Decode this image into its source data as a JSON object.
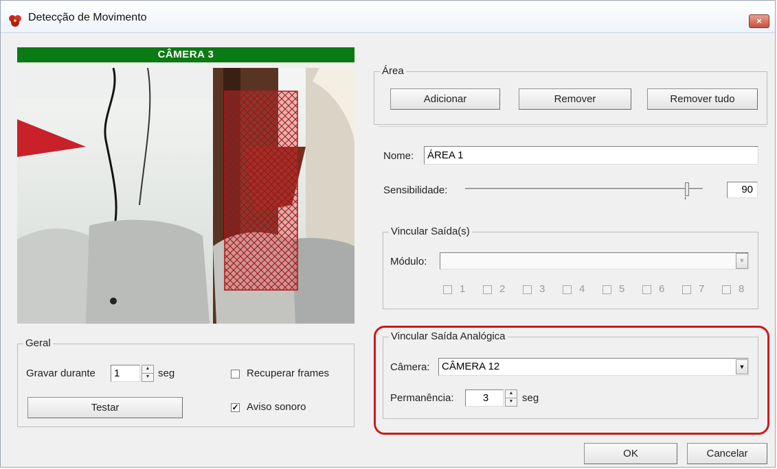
{
  "window": {
    "title": "Detecção de Movimento",
    "close_icon": "×"
  },
  "camera": {
    "header": "CÂMERA 3"
  },
  "area": {
    "group_title": "Área",
    "add_label": "Adicionar",
    "remove_label": "Remover",
    "remove_all_label": "Remover tudo",
    "name_label": "Nome:",
    "name_value": "ÁREA 1",
    "sensitivity_label": "Sensibilidade:",
    "sensitivity_value": "90"
  },
  "outputs": {
    "group_title": "Vincular Saída(s)",
    "module_label": "Módulo:",
    "module_value": "",
    "items": [
      "1",
      "2",
      "3",
      "4",
      "5",
      "6",
      "7",
      "8"
    ]
  },
  "analog": {
    "group_title": "Vincular Saída Analógica",
    "camera_label": "Câmera:",
    "camera_value": "CÂMERA 12",
    "permanence_label": "Permanência:",
    "permanence_value": "3",
    "unit": "seg"
  },
  "general": {
    "group_title": "Geral",
    "record_label": "Gravar durante",
    "record_value": "1",
    "unit": "seg",
    "recover_frames_label": "Recuperar frames",
    "recover_frames_checked": false,
    "sound_alert_label": "Aviso sonoro",
    "sound_alert_checked": true,
    "test_label": "Testar"
  },
  "footer": {
    "ok_label": "OK",
    "cancel_label": "Cancelar"
  },
  "colors": {
    "header_green": "#0a7a12",
    "highlight_red": "#cc1a1a",
    "area_overlay": "#c0392b"
  }
}
